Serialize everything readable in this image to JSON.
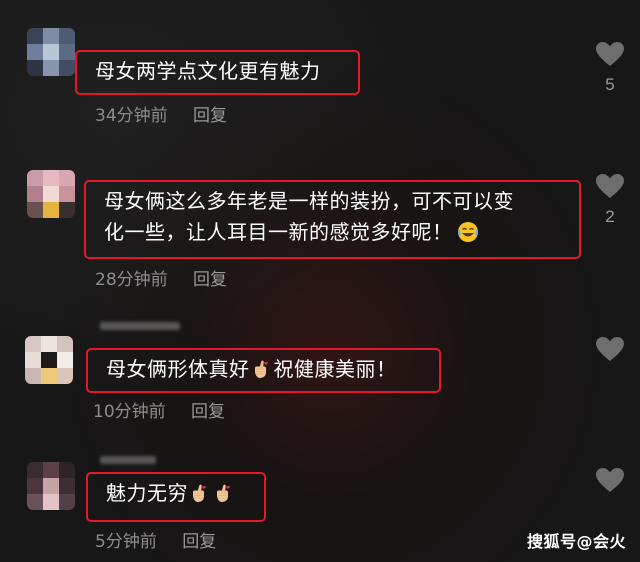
{
  "comments": [
    {
      "text": "母女两学点文化更有魅力",
      "time": "34分钟前",
      "reply": "回复",
      "likes": "5"
    },
    {
      "text_line1": "母女俩这么多年老是一样的装扮，可不可以变",
      "text_line2": "化一些，让人耳目一新的感觉多好呢！",
      "time": "28分钟前",
      "reply": "回复",
      "likes": "2",
      "emoji": "laughing-tears-icon"
    },
    {
      "text_part1": "母女俩形体真好",
      "text_part2": "祝健康美丽！",
      "time": "10分钟前",
      "reply": "回复",
      "likes": "",
      "emoji": "finger-heart-icon"
    },
    {
      "text": "魅力无穷",
      "time": "5分钟前",
      "reply": "回复",
      "likes": "",
      "emoji": "finger-heart-icon"
    }
  ],
  "watermark": "搜狐号@会火",
  "colors": {
    "highlight_box": "#e3192b",
    "background": "#171717",
    "text": "#ffffff",
    "meta_text": "#8d8d8d",
    "like_icon": "#6e6e6e"
  }
}
